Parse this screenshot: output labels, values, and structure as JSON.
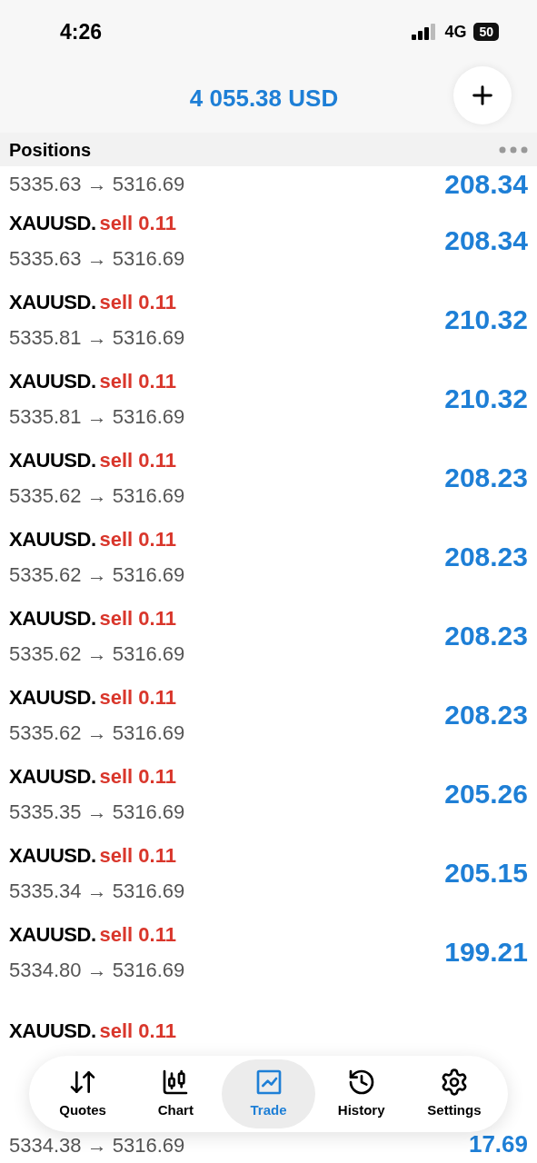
{
  "status_bar": {
    "time": "4:26",
    "network": "4G",
    "battery": "50"
  },
  "header": {
    "balance": "4 055.38 USD"
  },
  "section": {
    "title": "Positions"
  },
  "positions": [
    {
      "price": "5335.63 → 5316.69",
      "profit": "208.34"
    },
    {
      "symbol": "XAUUSD.",
      "side": "sell 0.11",
      "price": "5335.63 → 5316.69",
      "profit": "208.34"
    },
    {
      "symbol": "XAUUSD.",
      "side": "sell 0.11",
      "price": "5335.81 → 5316.69",
      "profit": "210.32"
    },
    {
      "symbol": "XAUUSD.",
      "side": "sell 0.11",
      "price": "5335.81 → 5316.69",
      "profit": "210.32"
    },
    {
      "symbol": "XAUUSD.",
      "side": "sell 0.11",
      "price": "5335.62 → 5316.69",
      "profit": "208.23"
    },
    {
      "symbol": "XAUUSD.",
      "side": "sell 0.11",
      "price": "5335.62 → 5316.69",
      "profit": "208.23"
    },
    {
      "symbol": "XAUUSD.",
      "side": "sell 0.11",
      "price": "5335.62 → 5316.69",
      "profit": "208.23"
    },
    {
      "symbol": "XAUUSD.",
      "side": "sell 0.11",
      "price": "5335.62 → 5316.69",
      "profit": "208.23"
    },
    {
      "symbol": "XAUUSD.",
      "side": "sell 0.11",
      "price": "5335.35 → 5316.69",
      "profit": "205.26"
    },
    {
      "symbol": "XAUUSD.",
      "side": "sell 0.11",
      "price": "5335.34 → 5316.69",
      "profit": "205.15"
    },
    {
      "symbol": "XAUUSD.",
      "side": "sell 0.11",
      "price": "5334.80 → 5316.69",
      "profit": "199.21"
    },
    {
      "symbol": "XAUUSD.",
      "side": "sell 0.11"
    },
    {
      "price": "5334.38 → 5316.69",
      "profit": "17.69"
    }
  ],
  "tab_bar": [
    {
      "kind": "quotes",
      "label": "Quotes",
      "selected": false
    },
    {
      "kind": "chart",
      "label": "Chart",
      "selected": false
    },
    {
      "kind": "trade",
      "label": "Trade",
      "selected": true
    },
    {
      "kind": "history",
      "label": "History",
      "selected": false
    },
    {
      "kind": "settings",
      "label": "Settings",
      "selected": false
    }
  ]
}
